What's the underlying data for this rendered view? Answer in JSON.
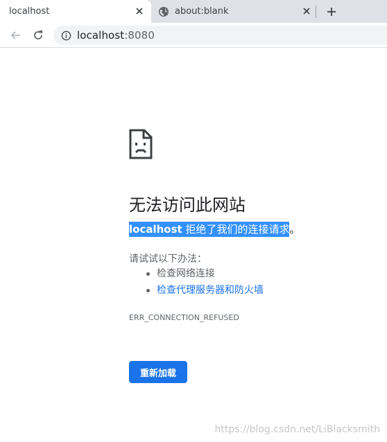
{
  "tabs": [
    {
      "title": "localhost",
      "active": true
    },
    {
      "title": "about:blank",
      "active": false
    }
  ],
  "toolbar": {
    "icons": [
      "back-arrow-icon",
      "reload-icon",
      "info-icon"
    ],
    "url_host": "localhost",
    "url_port": ":8080"
  },
  "error_page": {
    "heading": "无法访问此网站",
    "host": "localhost",
    "refused_text": " 拒绝了我们的连接请求",
    "period": "。",
    "try_label": "请试试以下办法：",
    "suggestions": [
      "检查网络连接",
      "检查代理服务器和防火墙"
    ],
    "error_code": "ERR_CONNECTION_REFUSED",
    "reload_label": "重新加载"
  },
  "colors": {
    "accent": "#1a73e8",
    "selection": "#3390ff",
    "tabstrip": "#dee1e6"
  },
  "watermark": "https://blog.csdn.net/LiBlacksmith"
}
